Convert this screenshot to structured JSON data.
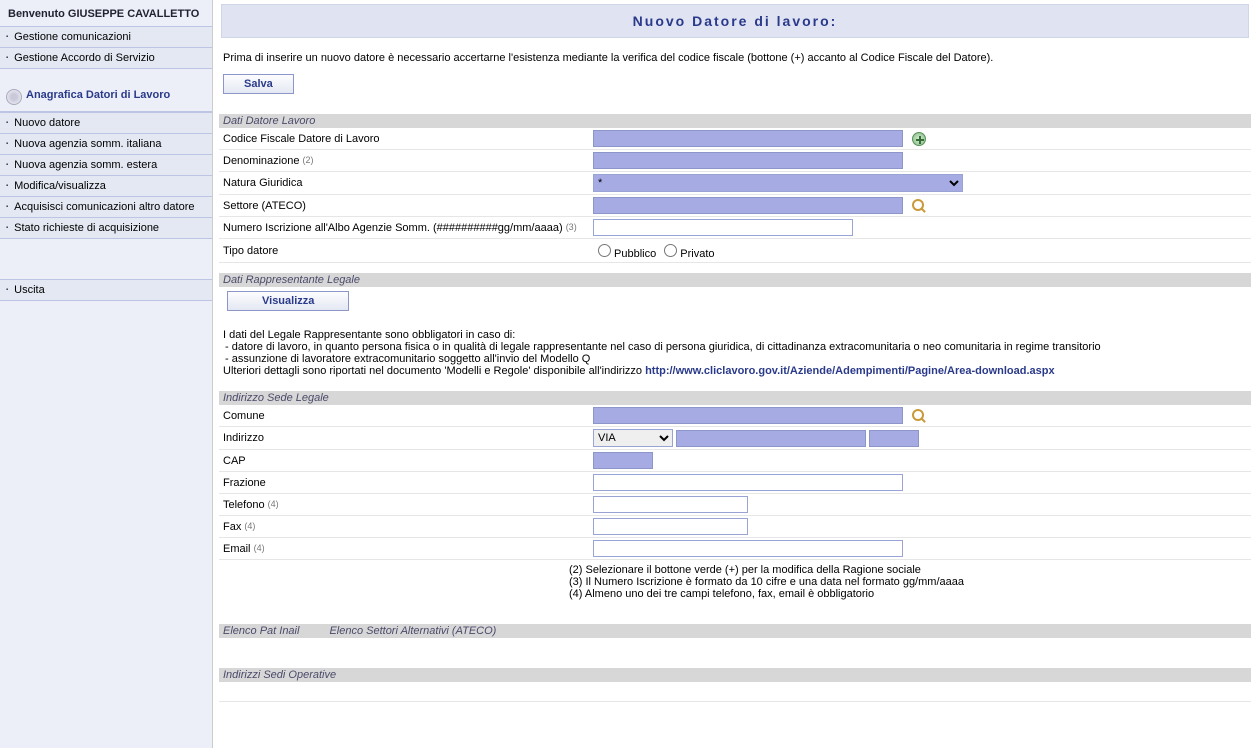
{
  "sidebar": {
    "welcome": "Benvenuto GIUSEPPE CAVALLETTO",
    "group1": [
      "Gestione comunicazioni",
      "Gestione Accordo di Servizio"
    ],
    "anagrafica_title": "Anagrafica Datori di Lavoro",
    "anagrafica_items": [
      "Nuovo datore",
      "Nuova agenzia somm. italiana",
      "Nuova agenzia somm. estera",
      "Modifica/visualizza",
      "Acquisisci comunicazioni altro datore",
      "Stato richieste di acquisizione"
    ],
    "uscita": "Uscita"
  },
  "title": "Nuovo Datore di lavoro:",
  "instruction": "Prima di inserire un nuovo datore è necessario accertarne l'esistenza mediante la verifica del codice fiscale (bottone (+) accanto al Codice Fiscale del Datore).",
  "save_label": "Salva",
  "sections": {
    "dati_datore": "Dati Datore Lavoro",
    "rappresentante": "Dati Rappresentante Legale",
    "sede_legale": "Indirizzo Sede Legale",
    "elenchi": {
      "pat": "Elenco Pat Inail",
      "ateco": "Elenco Settori Alternativi (ATECO)"
    },
    "sedi_op": "Indirizzi Sedi Operative"
  },
  "fields": {
    "codice_fiscale": {
      "label": "Codice Fiscale Datore di Lavoro",
      "value": ""
    },
    "denominazione": {
      "label": "Denominazione",
      "note": "(2)",
      "value": ""
    },
    "natura": {
      "label": "Natura Giuridica",
      "value": "*"
    },
    "settore": {
      "label": "Settore (ATECO)",
      "value": ""
    },
    "iscrizione": {
      "label": "Numero Iscrizione all'Albo Agenzie Somm. (##########gg/mm/aaaa)",
      "note": "(3)",
      "value": ""
    },
    "tipo_datore": {
      "label": "Tipo datore",
      "opt1": "Pubblico",
      "opt2": "Privato"
    },
    "visualizza_btn": "Visualizza",
    "comune": {
      "label": "Comune",
      "value": ""
    },
    "indirizzo": {
      "label": "Indirizzo",
      "type_value": "VIA",
      "value": "",
      "num": ""
    },
    "cap": {
      "label": "CAP",
      "value": ""
    },
    "frazione": {
      "label": "Frazione",
      "value": ""
    },
    "telefono": {
      "label": "Telefono",
      "note": "(4)",
      "value": ""
    },
    "fax": {
      "label": "Fax",
      "note": "(4)",
      "value": ""
    },
    "email": {
      "label": "Email",
      "note": "(4)",
      "value": ""
    }
  },
  "legal": {
    "intro": "I dati del Legale Rappresentante sono obbligatori in caso di:",
    "li1": "datore di lavoro, in quanto persona fisica o in qualità di legale rappresentante nel caso di persona giuridica, di cittadinanza extracomunitaria o neo comunitaria in regime transitorio",
    "li2": "assunzione di lavoratore extracomunitario soggetto all'invio del Modello Q",
    "more": "Ulteriori dettagli sono riportati nel documento 'Modelli e Regole' disponibile all'indirizzo ",
    "link": "http://www.cliclavoro.gov.it/Aziende/Adempimenti/Pagine/Area-download.aspx"
  },
  "notes": {
    "n2": "(2) Selezionare il bottone verde (+) per la modifica della Ragione sociale",
    "n3": "(3) Il Numero Iscrizione è formato da 10 cifre e una data nel formato gg/mm/aaaa",
    "n4": "(4) Almeno uno dei tre campi telefono, fax, email è obbligatorio"
  }
}
